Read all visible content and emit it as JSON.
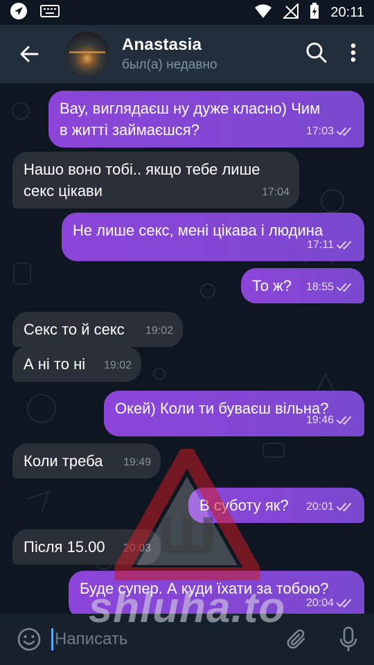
{
  "status_bar": {
    "time": "20:11"
  },
  "header": {
    "title": "Anastasia",
    "status": "был(а) недавно"
  },
  "messages": [
    {
      "dir": "out",
      "text_lines": [
        "Вау, виглядаєш ну дуже класно) Чим",
        "в житті займаєшся?"
      ],
      "time": "17:03",
      "read": true
    },
    {
      "dir": "in",
      "text_lines": [
        "Нашо воно тобі.. якщо тебе лише",
        "секс цікави"
      ],
      "time": "17:04"
    },
    {
      "dir": "out",
      "text_lines": [
        "Не лише секс, мені цікава і людина"
      ],
      "time": "17:11",
      "read": true
    },
    {
      "dir": "out",
      "text_lines": [
        "То ж?"
      ],
      "time": "18:55",
      "read": true
    },
    {
      "dir": "in",
      "text_lines": [
        "Секс то й секс"
      ],
      "time": "19:02"
    },
    {
      "dir": "in",
      "text_lines": [
        "А ні то ні"
      ],
      "time": "19:02"
    },
    {
      "dir": "out",
      "text_lines": [
        "Окей) Коли ти буваєш вільна?"
      ],
      "time": "19:46",
      "read": true
    },
    {
      "dir": "in",
      "text_lines": [
        "Коли треба"
      ],
      "time": "19:49"
    },
    {
      "dir": "out",
      "text_lines": [
        "В суботу як?"
      ],
      "time": "20:01",
      "read": true
    },
    {
      "dir": "in",
      "text_lines": [
        "Після 15.00"
      ],
      "time": "20:03"
    },
    {
      "dir": "out",
      "text_lines": [
        "Буде супер. А куди їхати за тобою?"
      ],
      "time": "20:04",
      "read": true
    }
  ],
  "input": {
    "placeholder": "Написать"
  },
  "watermark": {
    "text": "shluha.to",
    "logo_letter": "Ш"
  },
  "colors": {
    "outgoing": "#8a46d6",
    "incoming": "#2a2f38",
    "header": "#232e3c",
    "accent": "#5aa8ff"
  }
}
